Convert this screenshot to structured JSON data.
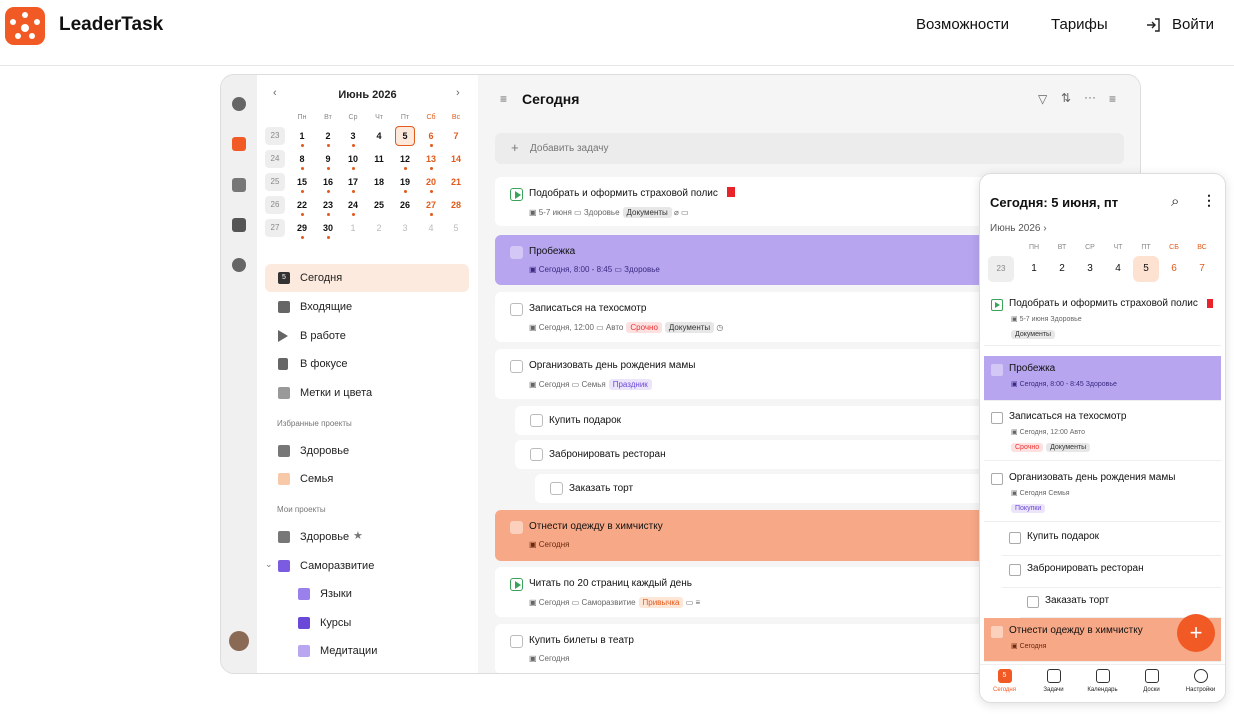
{
  "header": {
    "brand": "LeaderTask",
    "nav": [
      "Возможности",
      "Тарифы"
    ],
    "login": "Войти"
  },
  "calendar": {
    "month": "Июнь 2026",
    "weekdays": [
      "Пн",
      "Вт",
      "Ср",
      "Чт",
      "Пт",
      "Сб",
      "Вс"
    ],
    "weeks": [
      {
        "num": "23",
        "days": [
          "1",
          "2",
          "3",
          "4",
          "5",
          "6",
          "7"
        ]
      },
      {
        "num": "24",
        "days": [
          "8",
          "9",
          "10",
          "11",
          "12",
          "13",
          "14"
        ]
      },
      {
        "num": "25",
        "days": [
          "15",
          "16",
          "17",
          "18",
          "19",
          "20",
          "21"
        ]
      },
      {
        "num": "26",
        "days": [
          "22",
          "23",
          "24",
          "25",
          "26",
          "27",
          "28"
        ]
      },
      {
        "num": "27",
        "days": [
          "29",
          "30",
          "1",
          "2",
          "3",
          "4",
          "5"
        ]
      }
    ]
  },
  "sidebar": {
    "items": [
      "Сегодня",
      "Входящие",
      "В работе",
      "В фокусе",
      "Метки и цвета"
    ],
    "today_day": "5",
    "fav_label": "Избранные проекты",
    "fav_projects": [
      "Здоровье",
      "Семья"
    ],
    "my_label": "Мои проекты",
    "my_projects": [
      "Здоровье",
      "Саморазвитие",
      "Языки",
      "Курсы",
      "Медитации"
    ]
  },
  "main": {
    "title": "Сегодня",
    "add_task": "Добавить задачу",
    "tasks": [
      {
        "title": "Подобрать и оформить страховой полис",
        "date": "5-7 июня",
        "project": "Здоровье",
        "tags": [
          "Документы"
        ]
      },
      {
        "title": "Пробежка",
        "date": "Сегодня, 8:00 - 8:45",
        "project": "Здоровье",
        "tags": []
      },
      {
        "title": "Записаться на техосмотр",
        "date": "Сегодня, 12:00",
        "project": "Авто",
        "tags": [
          "Срочно",
          "Документы"
        ]
      },
      {
        "title": "Организовать день рождения мамы",
        "date": "Сегодня",
        "project": "Семья",
        "tags": [
          "Праздник"
        ]
      },
      {
        "title": "Купить подарок"
      },
      {
        "title": "Забронировать ресторан"
      },
      {
        "title": "Заказать торт"
      },
      {
        "title": "Отнести одежду в химчистку",
        "date": "Сегодня"
      },
      {
        "title": "Читать по 20 страниц каждый день",
        "date": "Сегодня",
        "project": "Саморазвитие",
        "tags": [
          "Привычка"
        ]
      },
      {
        "title": "Купить билеты в театр",
        "date": "Сегодня"
      }
    ]
  },
  "phone": {
    "title": "Сегодня: 5 июня, пт",
    "month": "Июнь 2026",
    "weekdays": [
      "ПН",
      "ВТ",
      "СР",
      "ЧТ",
      "ПТ",
      "СБ",
      "ВС"
    ],
    "week_num": "23",
    "days": [
      "1",
      "2",
      "3",
      "4",
      "5",
      "6",
      "7"
    ],
    "tasks": [
      {
        "title": "Подобрать и оформить страховой полис",
        "meta": "5-7 июня  Здоровье",
        "tags": [
          "Документы"
        ]
      },
      {
        "title": "Пробежка",
        "meta": "Сегодня, 8:00 - 8:45  Здоровье"
      },
      {
        "title": "Записаться на техосмотр",
        "meta": "Сегодня, 12:00  Авто",
        "tags": [
          "Срочно",
          "Документы"
        ]
      },
      {
        "title": "Организовать день рождения мамы",
        "meta": "Сегодня  Семья",
        "tags": [
          "Покупки"
        ]
      },
      {
        "title": "Купить подарок"
      },
      {
        "title": "Забронировать ресторан"
      },
      {
        "title": "Заказать торт"
      },
      {
        "title": "Отнести одежду в химчистку",
        "meta": "Сегодня"
      }
    ],
    "nav": [
      "Сегодня",
      "Задачи",
      "Календарь",
      "Доски",
      "Настройки"
    ],
    "today_badge": "5"
  },
  "colors": {
    "accent": "#f15a24",
    "purple_task": "#b7a5ef",
    "orange_task": "#f7a887"
  }
}
